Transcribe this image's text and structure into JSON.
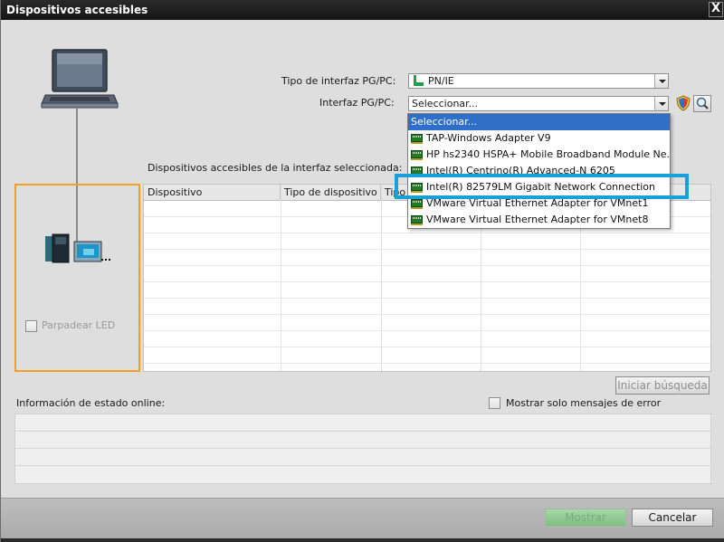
{
  "window": {
    "title": "Dispositivos accesibles",
    "close_glyph": "X"
  },
  "interface": {
    "type_label": "Tipo de interfaz PG/PC:",
    "type_value": "PN/IE",
    "iface_label": "Interfaz PG/PC:",
    "iface_value": "Seleccionar..."
  },
  "dropdown": {
    "items": [
      {
        "label": "Seleccionar...",
        "icon": "none",
        "selected": true
      },
      {
        "label": "TAP-Windows Adapter V9",
        "icon": "network-card-icon"
      },
      {
        "label": "HP hs2340 HSPA+ Mobile Broadband Module Ne...",
        "icon": "network-card-icon"
      },
      {
        "label": "Intel(R) Centrino(R) Advanced-N 6205",
        "icon": "network-card-icon"
      },
      {
        "label": "Intel(R) 82579LM Gigabit Network Connection",
        "icon": "network-card-icon",
        "highlighted": true
      },
      {
        "label": "VMware Virtual Ethernet Adapter for VMnet1",
        "icon": "network-card-icon"
      },
      {
        "label": "VMware Virtual Ethernet Adapter for VMnet8",
        "icon": "network-card-icon"
      }
    ],
    "highlight_color": "#1aa0d8",
    "selected_color": "#2f6fc8"
  },
  "devices": {
    "section_label": "Dispositivos accesibles de la interfaz seleccionada:",
    "columns": [
      "Dispositivo",
      "Tipo de dispositivo",
      "Tipo"
    ],
    "rows": []
  },
  "left_panel": {
    "blink_led_label": "Parpadear LED",
    "border_color": "#f0a024"
  },
  "search_button": "Iniciar búsqueda",
  "status": {
    "label": "Información de estado online:",
    "errors_only_label": "Mostrar solo mensajes de error"
  },
  "footer": {
    "show_button": "Mostrar",
    "cancel_button": "Cancelar"
  }
}
